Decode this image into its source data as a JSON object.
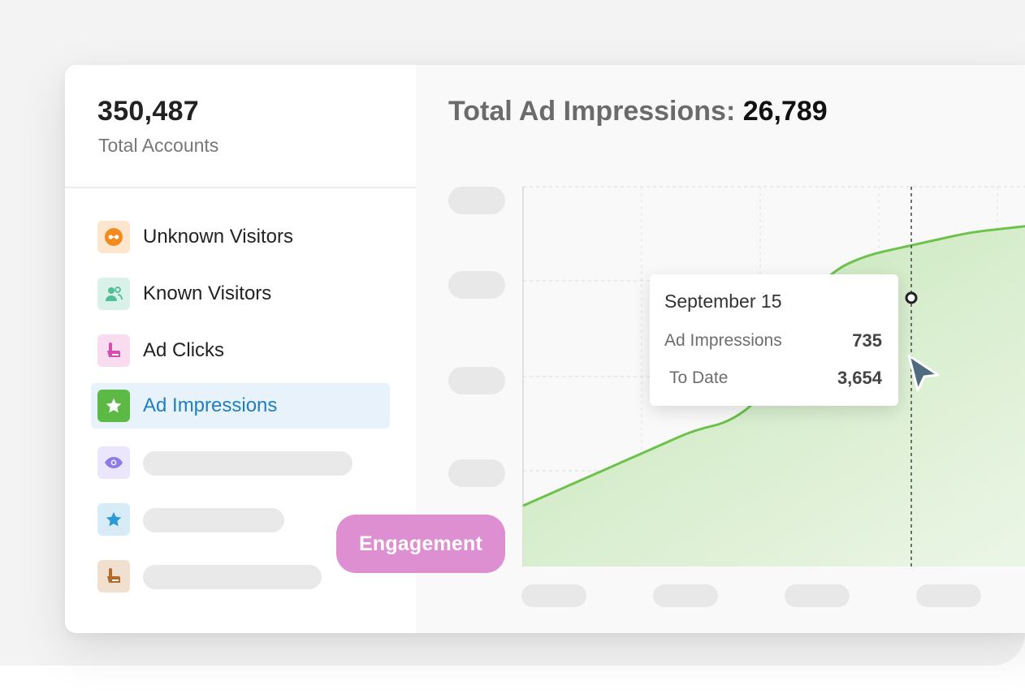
{
  "summary": {
    "value": "350,487",
    "label": "Total Accounts"
  },
  "nav": {
    "items": [
      {
        "label": "Unknown Visitors",
        "icon": "glasses-icon",
        "icon_bg": "#fde6cd",
        "icon_color": "#f28a1e"
      },
      {
        "label": "Known Visitors",
        "icon": "users-icon",
        "icon_bg": "#d9f1e8",
        "icon_color": "#4fbf96"
      },
      {
        "label": "Ad Clicks",
        "icon": "pointer-hand-icon",
        "icon_bg": "#f9dcef",
        "icon_color": "#d64fb0"
      },
      {
        "label": "Ad Impressions",
        "icon": "star-icon",
        "icon_bg": "#5cb945",
        "icon_color": "#ffffff",
        "active": true
      },
      {
        "icon": "eye-icon",
        "icon_bg": "#ebe6fb",
        "icon_color": "#8c7be8"
      },
      {
        "icon": "star-icon",
        "icon_bg": "#d8ecf8",
        "icon_color": "#2c9ad8"
      },
      {
        "icon": "pointer-hand-icon",
        "icon_bg": "#f1e0cf",
        "icon_color": "#b56a2a"
      }
    ]
  },
  "chart": {
    "title_prefix": "Total Ad Impressions: ",
    "title_value": "26,789",
    "line_color": "#6cc24a",
    "fill_color": "#cbe8bd"
  },
  "chart_data": {
    "type": "area",
    "series": [
      {
        "values": [
          0.84,
          0.8,
          0.76,
          0.72,
          0.68,
          0.64,
          0.62,
          0.55,
          0.32,
          0.22,
          0.18,
          0.16,
          0.14,
          0.12,
          0.11,
          0.1
        ]
      }
    ],
    "grid": true
  },
  "tooltip": {
    "date": "September 15",
    "rows": [
      {
        "label": "Ad Impressions",
        "value": "735"
      },
      {
        "label": "To Date",
        "value": "3,654"
      }
    ]
  },
  "badge": {
    "label": "Engagement",
    "color": "#dd8fd2"
  }
}
